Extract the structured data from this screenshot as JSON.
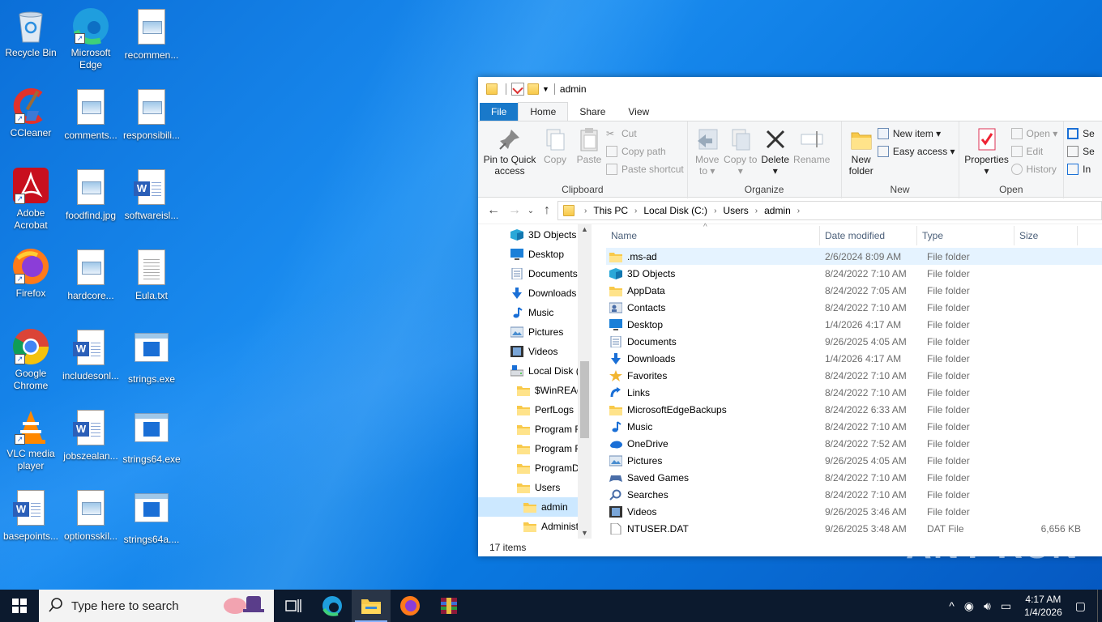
{
  "desktop": {
    "icons": [
      {
        "label": "Recycle Bin"
      },
      {
        "label": "Microsoft Edge"
      },
      {
        "label": "recommen..."
      },
      {
        "label": "CCleaner"
      },
      {
        "label": "comments..."
      },
      {
        "label": "responsibili..."
      },
      {
        "label": "Adobe Acrobat"
      },
      {
        "label": "foodfind.jpg"
      },
      {
        "label": "softwareisl..."
      },
      {
        "label": "Firefox"
      },
      {
        "label": "hardcore..."
      },
      {
        "label": "Eula.txt"
      },
      {
        "label": "Google Chrome"
      },
      {
        "label": "includesonl..."
      },
      {
        "label": "strings.exe"
      },
      {
        "label": "VLC media player"
      },
      {
        "label": "jobszealan..."
      },
      {
        "label": "strings64.exe"
      },
      {
        "label": "basepoints..."
      },
      {
        "label": "optionsskil..."
      },
      {
        "label": "strings64a...."
      }
    ]
  },
  "explorer": {
    "title": "admin",
    "tabs": {
      "file": "File",
      "home": "Home",
      "share": "Share",
      "view": "View"
    },
    "ribbon": {
      "pin_quick_access": "Pin to Quick access",
      "copy": "Copy",
      "paste": "Paste",
      "cut": "Cut",
      "copy_path": "Copy path",
      "paste_shortcut": "Paste shortcut",
      "clipboard": "Clipboard",
      "move_to": "Move to",
      "copy_to": "Copy to",
      "delete": "Delete",
      "rename": "Rename",
      "organize": "Organize",
      "new_folder": "New folder",
      "new_item": "New item",
      "easy_access": "Easy access",
      "new": "New",
      "properties": "Properties",
      "open": "Open",
      "edit": "Edit",
      "history": "History",
      "open_group": "Open",
      "select_all": "Se",
      "select_none": "Se",
      "invert": "In"
    },
    "breadcrumb": [
      "This PC",
      "Local Disk (C:)",
      "Users",
      "admin"
    ],
    "nav": [
      {
        "label": "3D Objects",
        "icon": "cube-icon"
      },
      {
        "label": "Desktop",
        "icon": "desktop-icon"
      },
      {
        "label": "Documents",
        "icon": "documents-icon"
      },
      {
        "label": "Downloads",
        "icon": "download-icon"
      },
      {
        "label": "Music",
        "icon": "music-icon"
      },
      {
        "label": "Pictures",
        "icon": "pictures-icon"
      },
      {
        "label": "Videos",
        "icon": "videos-icon"
      },
      {
        "label": "Local Disk (C:)",
        "icon": "drive-icon"
      },
      {
        "label": "$WinREAgent",
        "icon": "folder-icon"
      },
      {
        "label": "PerfLogs",
        "icon": "folder-icon"
      },
      {
        "label": "Program Files",
        "icon": "folder-icon"
      },
      {
        "label": "Program Files",
        "icon": "folder-icon"
      },
      {
        "label": "ProgramData",
        "icon": "folder-icon"
      },
      {
        "label": "Users",
        "icon": "folder-icon"
      },
      {
        "label": "admin",
        "icon": "folder-icon"
      },
      {
        "label": "Administrat",
        "icon": "folder-icon"
      }
    ],
    "columns": {
      "name": "Name",
      "date": "Date modified",
      "type": "Type",
      "size": "Size"
    },
    "files": [
      {
        "name": ".ms-ad",
        "date": "2/6/2024 8:09 AM",
        "type": "File folder",
        "size": "",
        "icon": "folder-icon"
      },
      {
        "name": "3D Objects",
        "date": "8/24/2022 7:10 AM",
        "type": "File folder",
        "size": "",
        "icon": "cube-icon"
      },
      {
        "name": "AppData",
        "date": "8/24/2022 7:05 AM",
        "type": "File folder",
        "size": "",
        "icon": "folder-icon"
      },
      {
        "name": "Contacts",
        "date": "8/24/2022 7:10 AM",
        "type": "File folder",
        "size": "",
        "icon": "contacts-icon"
      },
      {
        "name": "Desktop",
        "date": "1/4/2026 4:17 AM",
        "type": "File folder",
        "size": "",
        "icon": "desktop-icon"
      },
      {
        "name": "Documents",
        "date": "9/26/2025 4:05 AM",
        "type": "File folder",
        "size": "",
        "icon": "documents-icon"
      },
      {
        "name": "Downloads",
        "date": "1/4/2026 4:17 AM",
        "type": "File folder",
        "size": "",
        "icon": "download-icon"
      },
      {
        "name": "Favorites",
        "date": "8/24/2022 7:10 AM",
        "type": "File folder",
        "size": "",
        "icon": "star-icon"
      },
      {
        "name": "Links",
        "date": "8/24/2022 7:10 AM",
        "type": "File folder",
        "size": "",
        "icon": "link-icon"
      },
      {
        "name": "MicrosoftEdgeBackups",
        "date": "8/24/2022 6:33 AM",
        "type": "File folder",
        "size": "",
        "icon": "folder-icon"
      },
      {
        "name": "Music",
        "date": "8/24/2022 7:10 AM",
        "type": "File folder",
        "size": "",
        "icon": "music-icon"
      },
      {
        "name": "OneDrive",
        "date": "8/24/2022 7:52 AM",
        "type": "File folder",
        "size": "",
        "icon": "cloud-icon"
      },
      {
        "name": "Pictures",
        "date": "9/26/2025 4:05 AM",
        "type": "File folder",
        "size": "",
        "icon": "pictures-icon"
      },
      {
        "name": "Saved Games",
        "date": "8/24/2022 7:10 AM",
        "type": "File folder",
        "size": "",
        "icon": "games-icon"
      },
      {
        "name": "Searches",
        "date": "8/24/2022 7:10 AM",
        "type": "File folder",
        "size": "",
        "icon": "search-icon"
      },
      {
        "name": "Videos",
        "date": "9/26/2025 3:46 AM",
        "type": "File folder",
        "size": "",
        "icon": "videos-icon"
      },
      {
        "name": "NTUSER.DAT",
        "date": "9/26/2025 3:48 AM",
        "type": "DAT File",
        "size": "6,656 KB",
        "icon": "file-icon"
      }
    ],
    "status": "17 items"
  },
  "taskbar": {
    "search_placeholder": "Type here to search",
    "time": "4:17 AM",
    "date": "1/4/2026"
  },
  "watermark": "ANY RUN"
}
